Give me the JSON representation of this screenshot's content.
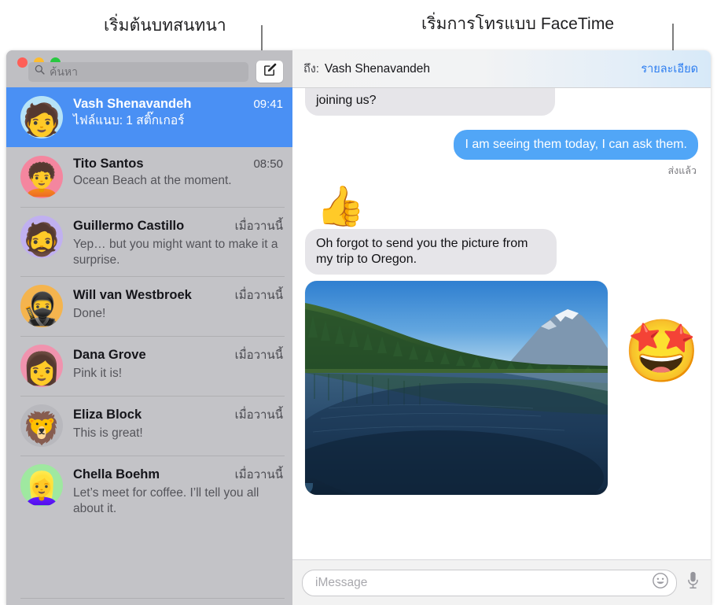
{
  "annotations": [
    {
      "id": "compose",
      "label": "เริ่มต้นบทสนทนา"
    },
    {
      "id": "facetime",
      "label": "เริ่มการโทรแบบ FaceTime"
    }
  ],
  "window": {
    "traffic_lights": [
      "close",
      "minimize",
      "zoom"
    ],
    "colors": {
      "close": "#ff5f57",
      "minimize": "#febc2e",
      "zoom": "#28c840",
      "selection": "#4a90f4",
      "outgoing_bubble": "#51a6f7",
      "incoming_bubble": "#e6e5e9",
      "link": "#2b7cf0"
    }
  },
  "sidebar": {
    "search": {
      "placeholder": "ค้นหา",
      "value": ""
    },
    "compose_button_label": "",
    "conversations": [
      {
        "name": "Vash Shenavandeh",
        "time": "09:41",
        "preview": "ไฟล์แนบ: 1 สติ๊กเกอร์",
        "avatar": "🧑",
        "avatar_bg": "#b6e3f7",
        "selected": true
      },
      {
        "name": "Tito Santos",
        "time": "08:50",
        "preview": "Ocean Beach at the moment.",
        "avatar": "🧑‍🦱",
        "avatar_bg": "#f4869f",
        "selected": false
      },
      {
        "name": "Guillermo Castillo",
        "time": "เมื่อวานนี้",
        "preview": "Yep… but you might want to make it a surprise.",
        "avatar": "🧔",
        "avatar_bg": "#c0b0f0",
        "selected": false
      },
      {
        "name": "Will van Westbroek",
        "time": "เมื่อวานนี้",
        "preview": "Done!",
        "avatar": "🥷",
        "avatar_bg": "#f4b44e",
        "selected": false
      },
      {
        "name": "Dana Grove",
        "time": "เมื่อวานนี้",
        "preview": "Pink it is!",
        "avatar": "👩",
        "avatar_bg": "#f093ae",
        "selected": false
      },
      {
        "name": "Eliza Block",
        "time": "เมื่อวานนี้",
        "preview": "This is great!",
        "avatar": "🦁",
        "avatar_bg": "#b8b8bd",
        "selected": false
      },
      {
        "name": "Chella Boehm",
        "time": "เมื่อวานนี้",
        "preview": "Let’s meet for coffee. I’ll tell you all about it.",
        "avatar": "👱‍♀️",
        "avatar_bg": "#9fe8a0",
        "selected": false
      }
    ]
  },
  "conversation": {
    "to_label": "ถึง:",
    "recipient": "Vash Shenavandeh",
    "details_link": "รายละเอียด",
    "messages": [
      {
        "kind": "text",
        "direction": "incoming",
        "text": "joining us?",
        "clipped": true
      },
      {
        "kind": "text",
        "direction": "outgoing",
        "text": "I am seeing them today, I can ask them.",
        "status": "ส่งแล้ว"
      },
      {
        "kind": "tapback",
        "direction": "incoming",
        "emoji": "👍"
      },
      {
        "kind": "text",
        "direction": "incoming",
        "text": "Oh forgot to send you the picture from my trip to Oregon."
      },
      {
        "kind": "photo",
        "direction": "incoming",
        "alt": "Lake with evergreen forest and snow-capped mountain",
        "sticker": "🤩"
      }
    ]
  },
  "composer": {
    "placeholder": "iMessage",
    "value": "",
    "emoji_button": "😀",
    "mic_button": "mic"
  }
}
